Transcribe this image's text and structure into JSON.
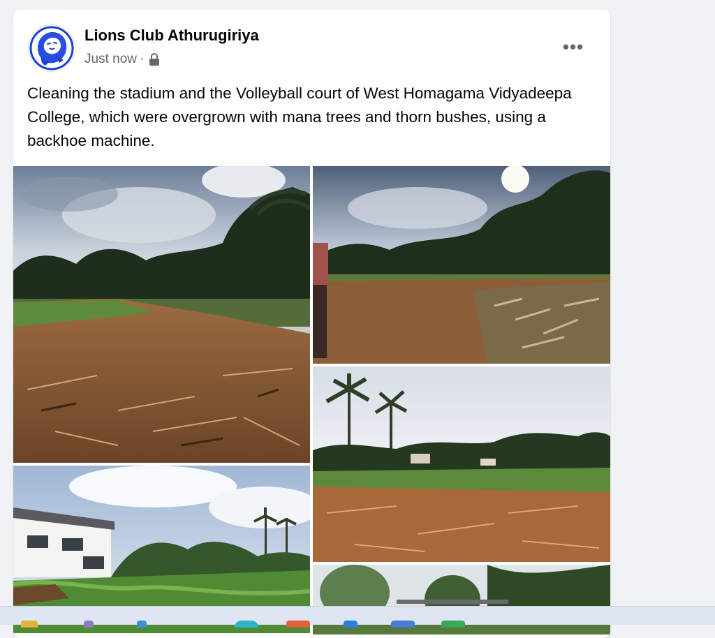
{
  "post": {
    "author": "Lions Club Athurugiriya",
    "timestamp": "Just now",
    "separator": "·",
    "privacy_icon": "lock-icon",
    "more_icon": "more-options-icon",
    "more_label": "•••",
    "text": "Cleaning the stadium and the Volleyball court of West Homagama Vidyadeepa College, which were overgrown with mana trees and thorn bushes, using a backhoe machine."
  },
  "photos": [
    {
      "name": "photo-1",
      "desc_icon": "field-cleared-dirt"
    },
    {
      "name": "photo-2",
      "desc_icon": "field-debris-piles"
    },
    {
      "name": "photo-3",
      "desc_icon": "field-with-palms"
    },
    {
      "name": "photo-4",
      "desc_icon": "building-and-palms"
    },
    {
      "name": "photo-5",
      "desc_icon": "trees-partial"
    }
  ],
  "colors": {
    "brand_blue": "#1a3fd1",
    "text_primary": "#050505",
    "text_secondary": "#65676b",
    "background": "#f0f2f5"
  },
  "taskbar": {
    "icons": [
      "folder-icon",
      "app-icon",
      "app-icon",
      "browser-icon",
      "app-icon",
      "app-icon",
      "app-icon",
      "app-icon"
    ]
  }
}
